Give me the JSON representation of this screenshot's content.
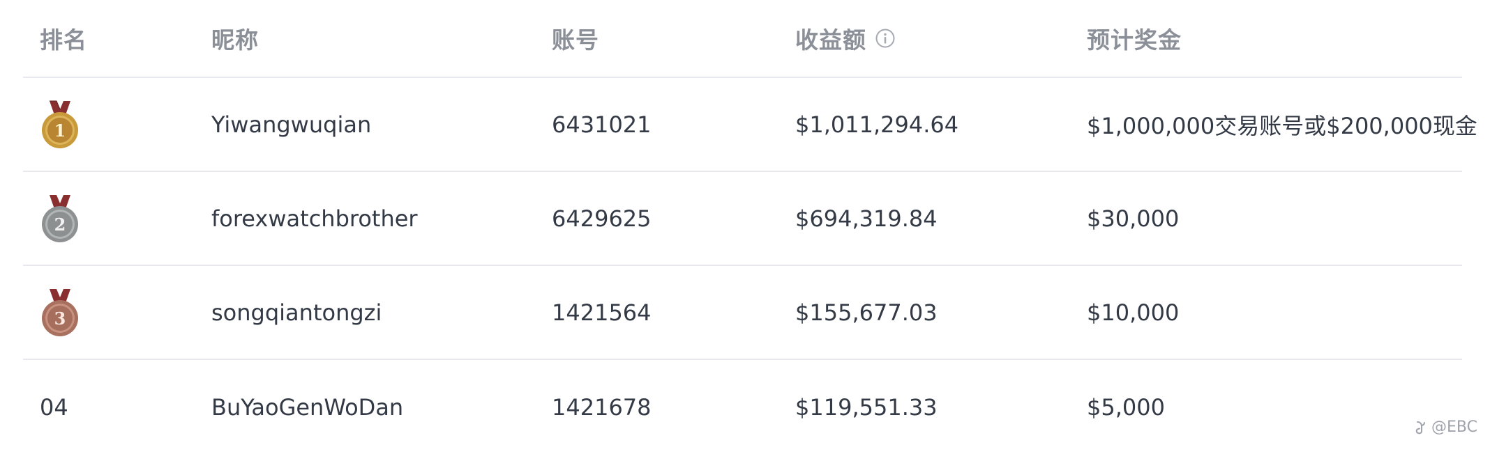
{
  "table": {
    "headers": {
      "rank": "排名",
      "nickname": "昵称",
      "account": "账号",
      "profit": "收益额",
      "prize": "预计奖金"
    },
    "rows": [
      {
        "rank": "1",
        "medal": "gold-medal-icon",
        "nickname": "Yiwangwuqian",
        "account": "6431021",
        "profit": "$1,011,294.64",
        "prize": "$1,000,000交易账号或$200,000现金"
      },
      {
        "rank": "2",
        "medal": "silver-medal-icon",
        "nickname": "forexwatchbrother",
        "account": "6429625",
        "profit": "$694,319.84",
        "prize": "$30,000"
      },
      {
        "rank": "3",
        "medal": "bronze-medal-icon",
        "nickname": "songqiantongzi",
        "account": "1421564",
        "profit": "$155,677.03",
        "prize": "$10,000"
      },
      {
        "rank": "04",
        "medal": "",
        "nickname": "BuYaoGenWoDan",
        "account": "1421678",
        "profit": "$119,551.33",
        "prize": "$5,000"
      }
    ]
  },
  "watermark": "@EBC",
  "colors": {
    "header_text": "#8b8f98",
    "body_text": "#333a45",
    "divider": "#e8e9ee",
    "gold": "#c99a3a",
    "silver": "#a0a3a4",
    "bronze": "#b98170",
    "ribbon": "#8a2f2f"
  }
}
